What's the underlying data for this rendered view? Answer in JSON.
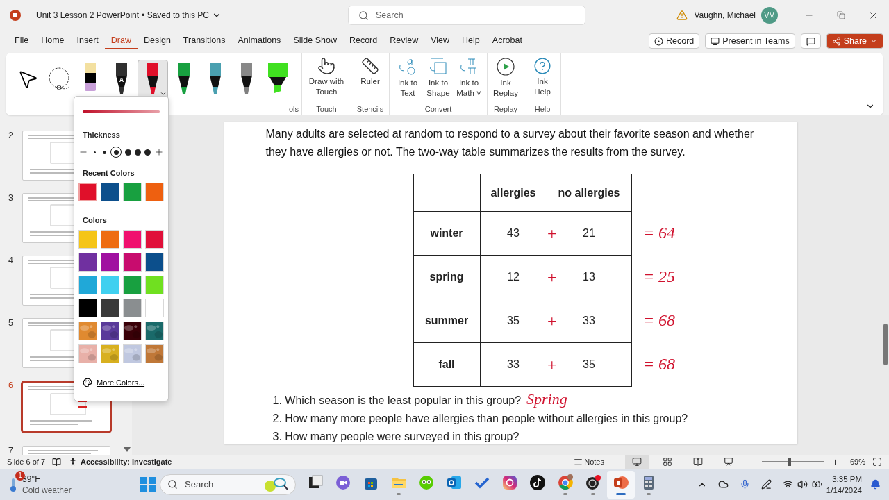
{
  "title_bar": {
    "document": "Unit 3 Lesson 2 PowerPoint",
    "save_status": "• Saved to this PC",
    "search": {
      "placeholder": "Search"
    },
    "user": "Vaughn, Michael",
    "avatar": "VM"
  },
  "menu_tabs": [
    {
      "label": "File",
      "selected": false
    },
    {
      "label": "Home",
      "selected": false
    },
    {
      "label": "Insert",
      "selected": false
    },
    {
      "label": "Draw",
      "selected": true
    },
    {
      "label": "Design",
      "selected": false
    },
    {
      "label": "Transitions",
      "selected": false
    },
    {
      "label": "Animations",
      "selected": false
    },
    {
      "label": "Slide Show",
      "selected": false
    },
    {
      "label": "Record",
      "selected": false
    },
    {
      "label": "Review",
      "selected": false
    },
    {
      "label": "View",
      "selected": false
    },
    {
      "label": "Help",
      "selected": false
    },
    {
      "label": "Acrobat",
      "selected": false
    }
  ],
  "menu_actions": [
    {
      "kind": "record",
      "label": "Record"
    },
    {
      "kind": "teams",
      "label": "Present in Teams"
    },
    {
      "kind": "comment"
    },
    {
      "kind": "share",
      "label": "Share"
    }
  ],
  "ribbon": {
    "tools": [
      {
        "kind": "select",
        "selected": false
      },
      {
        "kind": "lasso",
        "selected": false
      },
      {
        "kind": "eraser",
        "color": "#c8a0d8",
        "selected": false
      },
      {
        "kind": "action",
        "label": "A",
        "color": "#303030",
        "selected": false
      },
      {
        "kind": "pen",
        "color": "#e0102a",
        "selected": true
      },
      {
        "kind": "pen",
        "color": "#18a040",
        "selected": false
      },
      {
        "kind": "pen",
        "color": "#4aa0b0",
        "selected": false
      },
      {
        "kind": "pencil",
        "color": "#808080",
        "selected": false
      },
      {
        "kind": "highlighter",
        "color": "#40e020",
        "selected": false
      }
    ],
    "tools_group": "ols",
    "groups": [
      {
        "label": "Touch",
        "buttons": [
          {
            "kind": "touch",
            "label": "Draw with Touch"
          }
        ]
      },
      {
        "label": "Stencils",
        "buttons": [
          {
            "kind": "ruler",
            "label": "Ruler"
          }
        ]
      },
      {
        "label": "Convert",
        "buttons": [
          {
            "kind": "ink-text",
            "label": "Ink to Text"
          },
          {
            "kind": "ink-shape",
            "label": "Ink to Shape"
          },
          {
            "kind": "ink-math",
            "label": "Ink to Math ˅"
          }
        ]
      },
      {
        "label": "Replay",
        "buttons": [
          {
            "kind": "replay",
            "label": "Ink Replay"
          }
        ]
      },
      {
        "label": "Help",
        "buttons": [
          {
            "kind": "help",
            "label": "Ink Help"
          }
        ]
      }
    ]
  },
  "pen_menu": {
    "thickness_label": "Thickness",
    "thickness": [
      {
        "selected": false
      },
      {
        "selected": false
      },
      {
        "selected": true
      },
      {
        "selected": false
      },
      {
        "selected": false
      },
      {
        "selected": false
      }
    ],
    "recent_label": "Recent Colors",
    "recent_colors": [
      {
        "color": "#e0102a",
        "selected": true
      },
      {
        "color": "#0c4f8c",
        "selected": false
      },
      {
        "color": "#18a040",
        "selected": false
      },
      {
        "color": "#ee6010",
        "selected": false
      }
    ],
    "colors_label": "Colors",
    "colors": [
      {
        "kind": "solid",
        "color": "#f5c518"
      },
      {
        "kind": "solid",
        "color": "#ee6c12"
      },
      {
        "kind": "solid",
        "color": "#f0106e"
      },
      {
        "kind": "solid",
        "color": "#e0103a"
      },
      {
        "kind": "solid",
        "color": "#7030a0"
      },
      {
        "kind": "solid",
        "color": "#a010a0"
      },
      {
        "kind": "solid",
        "color": "#c80c6e"
      },
      {
        "kind": "solid",
        "color": "#0c4f8c"
      },
      {
        "kind": "solid",
        "color": "#20a8d8"
      },
      {
        "kind": "solid",
        "color": "#40d0f0"
      },
      {
        "kind": "solid",
        "color": "#18a040"
      },
      {
        "kind": "solid",
        "color": "#70e020"
      },
      {
        "kind": "solid",
        "color": "#000000"
      },
      {
        "kind": "solid",
        "color": "#3a3a3a"
      },
      {
        "kind": "solid",
        "color": "#8a8e90"
      },
      {
        "kind": "solid",
        "color": "#ffffff"
      },
      {
        "kind": "texture",
        "color": "#e08a30"
      },
      {
        "kind": "texture",
        "color": "#5a3a9a"
      },
      {
        "kind": "texture",
        "color": "#3a0008"
      },
      {
        "kind": "texture",
        "color": "#1a6a6a"
      },
      {
        "kind": "texture",
        "color": "#e8b0a8"
      },
      {
        "kind": "texture",
        "color": "#d8b020"
      },
      {
        "kind": "texture",
        "color": "#c0c8e0"
      },
      {
        "kind": "texture",
        "color": "#c07838"
      }
    ],
    "more_colors": "More Colors..."
  },
  "thumbnails": [
    {
      "number": "2",
      "selected": false
    },
    {
      "number": "3",
      "selected": false
    },
    {
      "number": "4",
      "selected": false
    },
    {
      "number": "5",
      "selected": false
    },
    {
      "number": "6",
      "selected": true
    },
    {
      "number": "7",
      "selected": false
    }
  ],
  "slide": {
    "intro": "Many adults are selected at random to respond to a survey about their favorite season and whether they have allergies or not. The two-way table summarizes the results from the survey.",
    "table": {
      "columns": [
        "allergies",
        "no allergies"
      ],
      "rows": [
        {
          "label": "winter",
          "values": [
            "43",
            "21"
          ],
          "ink_sign": "+",
          "ink_total": "= 64"
        },
        {
          "label": "spring",
          "values": [
            "12",
            "13"
          ],
          "ink_sign": "+",
          "ink_total": "= 25"
        },
        {
          "label": "summer",
          "values": [
            "35",
            "33"
          ],
          "ink_sign": "+",
          "ink_total": "= 68"
        },
        {
          "label": "fall",
          "values": [
            "33",
            "35"
          ],
          "ink_sign": "+",
          "ink_total": "= 68"
        }
      ]
    },
    "questions": [
      {
        "text": "1. Which season is the least popular in this group?",
        "ink_answer": "Spring"
      },
      {
        "text": "2. How many more people have allergies than people without allergies in this group?"
      },
      {
        "text": "3. How many people were surveyed in this group?"
      }
    ]
  },
  "status_bar": {
    "slide": "Slide 6 of 7",
    "accessibility": "Accessibility: Investigate",
    "notes": "Notes",
    "views": [
      {
        "kind": "normal",
        "selected": true
      },
      {
        "kind": "sorter",
        "selected": false
      },
      {
        "kind": "reading",
        "selected": false
      },
      {
        "kind": "show",
        "selected": false
      }
    ],
    "zoom": {
      "level": 0.45,
      "percent": "69%"
    }
  },
  "taskbar": {
    "weather": {
      "temp": "39°F",
      "condition": "Cold weather",
      "badge": "1"
    },
    "search": {
      "placeholder": "Search"
    },
    "apps": [
      {
        "kind": "taskview",
        "running": false,
        "selected": false
      },
      {
        "kind": "chat",
        "running": false,
        "selected": false
      },
      {
        "kind": "store",
        "running": false,
        "selected": false
      },
      {
        "kind": "explorer",
        "running": true,
        "selected": false
      },
      {
        "kind": "owl",
        "running": false,
        "selected": false
      },
      {
        "kind": "mail",
        "running": false,
        "selected": false
      },
      {
        "kind": "todo",
        "running": false,
        "selected": false
      },
      {
        "kind": "instagram",
        "running": false,
        "selected": false
      },
      {
        "kind": "tiktok",
        "running": false,
        "selected": false
      },
      {
        "kind": "chrome",
        "running": true,
        "selected": false
      },
      {
        "kind": "obs",
        "running": true,
        "selected": false
      },
      {
        "kind": "powerpoint",
        "running": true,
        "selected": true
      },
      {
        "kind": "calculator",
        "running": true,
        "selected": false
      }
    ],
    "time": "3:35 PM",
    "date": "1/14/2024"
  }
}
